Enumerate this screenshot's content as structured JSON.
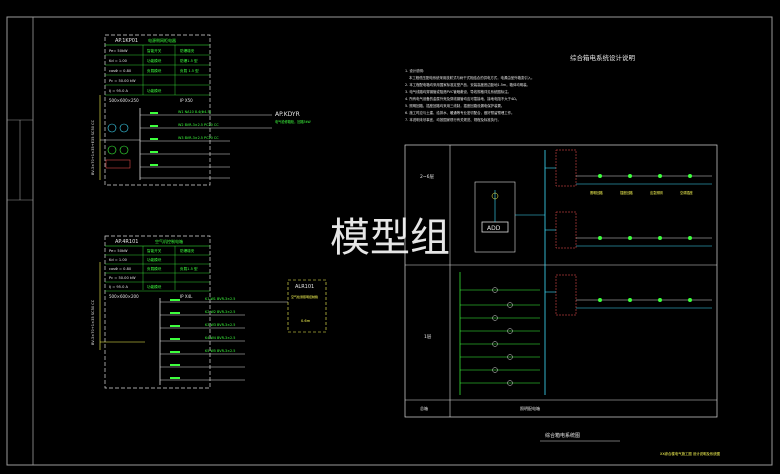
{
  "watermark": "模型组",
  "panel_top": {
    "id": "AP.1KP01",
    "desc": "电源侧网柜电器",
    "params": [
      "Pe= 50kW",
      "Kd = 1.00",
      "cosΦ = 0.80",
      "Pc = 50.00 kW",
      "Ij = 95.0 A"
    ],
    "mid_col": [
      "智能开关",
      "功能模块",
      "负载模块",
      "功能模块"
    ],
    "right_col": [
      "防爆增安",
      "防爆1.5 型",
      "负载 1.5 型"
    ],
    "dim": "500×600×250",
    "ip": "IP X50",
    "incoming": "BV-3×70+1×35+E35 SC50 CC",
    "out_label": "AP.KDYR",
    "out_desc": "电气检修箱柜，回路5kW",
    "rows": [
      "W1 NA10 8.4(Φ4.5)",
      "W2 BVR-3×2.5 PC20 CC",
      "W3 BVR-3×2.5 PC20 CC"
    ]
  },
  "panel_bottom": {
    "id": "AP.4R101",
    "desc": "空气机控制电箱",
    "params": [
      "Pe= 50kW",
      "Kd = 1.00",
      "cosΦ = 0.80",
      "Pc = 50.00 kW",
      "Ij = 95.0 A"
    ],
    "mid_col": [
      "智能开关",
      "功能模块",
      "负载模块",
      "功能模块"
    ],
    "right_col": [
      "防爆增安",
      "负载1.5 型"
    ],
    "dim": "500×600×200",
    "ip": "IP X4L",
    "incoming": "BV-3×70+1×35 SC50 CC",
    "rows": [
      "K1 W1 BVR-3×2.5",
      "K2 W2 BVR-3×2.5",
      "K3 W3 BVR-3×2.5",
      "K4 W4 BVR-3×2.5",
      "K5 W5 BVR-3×2.5"
    ],
    "side_box": {
      "id": "ALR101",
      "desc": "空气检测照明控制箱",
      "val": "0.6m"
    }
  },
  "notes_title": "综合箱电系统设计说明",
  "notes": [
    "1. 设计说明：",
    "本工程低压配电系统采用放射式与树干式相结合的供电方式，电源由室外箱变引入。",
    "2. 本工程配电箱均采用国家标准定型产品，安装高度底边距地1.5m，箱体均明装。",
    "3. 电气线路均穿钢管或阻燃PVC管暗敷设，导线规格详见系统图标注。",
    "4. 所有电气设备的金属外壳及穿线钢管均应可靠接地，接地电阻不大于4Ω。",
    "5. 照明回路、插座回路均采用三线制，插座回路设漏电保护装置。",
    "6. 施工时应与土建、给排水、暖通等专业密切配合，做好预留预埋工作。",
    "7. 本说明未尽事宜，均按国家现行有关规范、规程及标准执行。"
  ],
  "riser": {
    "floor_upper": "2~6层",
    "floor_lower": "1层",
    "add_box": "ADD",
    "bottom_left": "总箱",
    "bottom_mid": "照明配电箱",
    "title": "综合箱电系统图",
    "branch_labels": [
      "照明回路",
      "插座回路",
      "应急照明",
      "空调插座"
    ],
    "footer": "XX综合楼电气施工图 设计说明及系统图"
  }
}
